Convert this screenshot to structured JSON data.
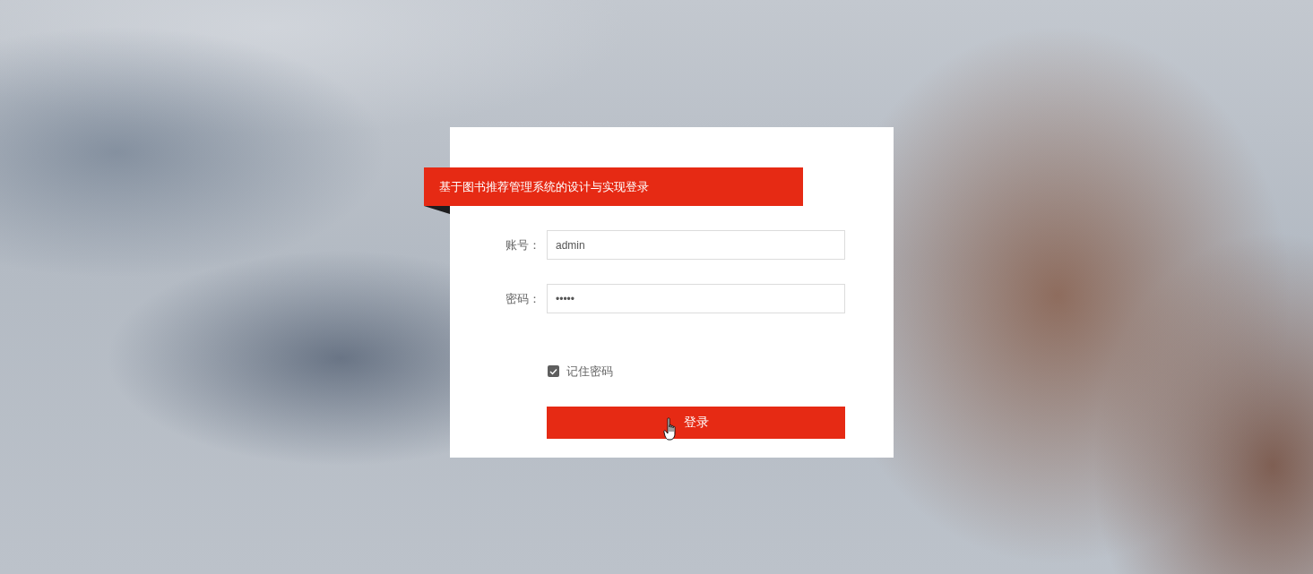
{
  "title": "基于图书推荐管理系统的设计与实现登录",
  "fields": [
    {
      "label": "账号：",
      "value": "admin"
    },
    {
      "label": "密码：",
      "value": "•••••"
    }
  ],
  "remember": {
    "label": "记住密码",
    "checked": true
  },
  "submit": {
    "label": "登录"
  }
}
